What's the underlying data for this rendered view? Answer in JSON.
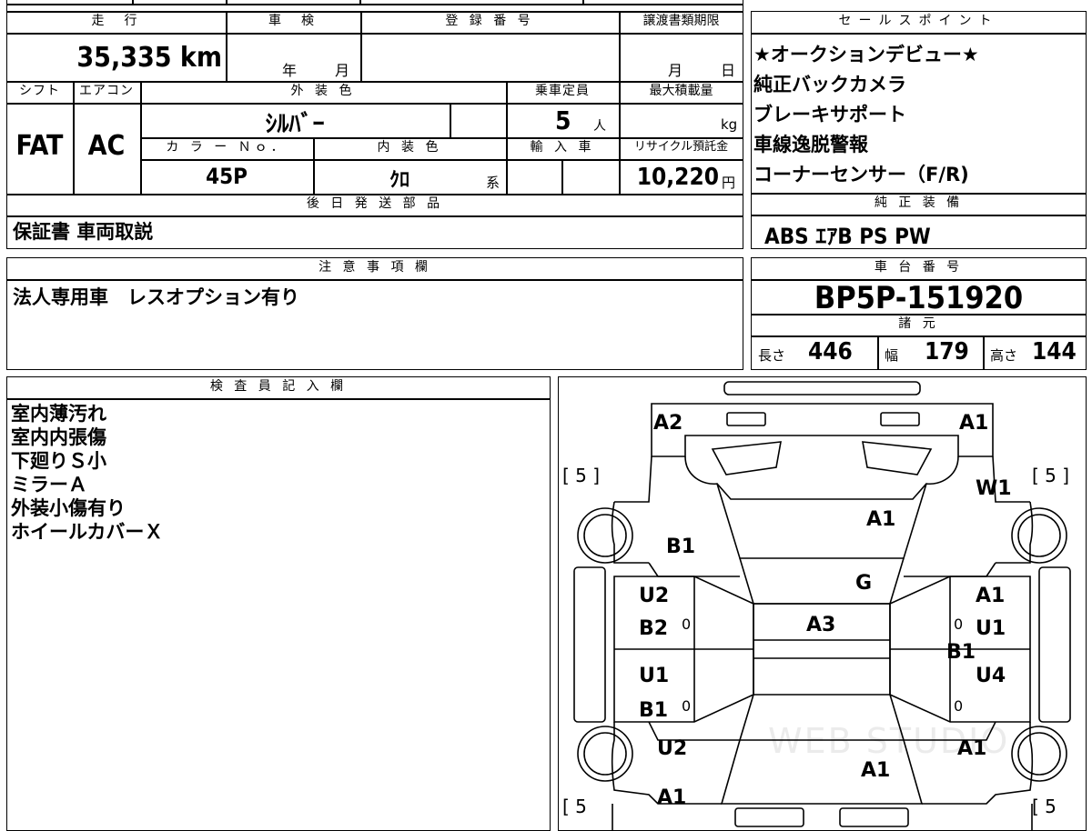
{
  "basic": {
    "mileage_hdr": "走　行",
    "mileage": "35,335 km",
    "shaken_hdr": "車　検",
    "shaken_year": "年",
    "shaken_month": "月",
    "reg_hdr": "登 録 番 号",
    "transfer_hdr": "譲渡書類期限",
    "transfer_month": "月",
    "transfer_day": "日",
    "shift_hdr": "シフト",
    "aircon_hdr": "エアコン",
    "color_hdr": "外 装 色",
    "capacity_hdr": "乗車定員",
    "maxload_hdr": "最大積載量",
    "shift": "FAT",
    "aircon": "AC",
    "color": "ｼﾙﾊﾞｰ",
    "capacity": "5",
    "capacity_unit": "人",
    "maxload_unit": "kg",
    "colorno_hdr": "カ ラ ー Ｎｏ．",
    "interior_hdr": "内 装 色",
    "import_hdr": "輸 入 車",
    "recycle_hdr": "リサイクル預託金",
    "colorno": "45P",
    "interior": "ｸﾛ",
    "interior_suffix": "系",
    "recycle": "10,220",
    "recycle_unit": "円"
  },
  "later": {
    "hdr": "後 日 発 送 部 品",
    "text": "保証書 車両取説"
  },
  "sales": {
    "hdr": "セールスポイント",
    "items": [
      "★オークションデビュー★",
      "純正バックカメラ",
      "ブレーキサポート",
      "車線逸脱警報",
      "コーナーセンサー（F/R)"
    ]
  },
  "equip": {
    "hdr": "純 正 装 備",
    "text": "ABS ｴｱB PS PW"
  },
  "caution": {
    "hdr": "注 意 事 項 欄",
    "text": "法人専用車　レスオプション有り"
  },
  "chassis": {
    "hdr": "車 台 番 号",
    "number": "BP5P-151920",
    "spec_hdr": "諸 元",
    "len_label": "長さ",
    "len": "446",
    "wid_label": "幅",
    "wid": "179",
    "hgt_label": "高さ",
    "hgt": "144"
  },
  "inspector": {
    "hdr": "検 査 員 記 入 欄",
    "lines": [
      "室内薄汚れ",
      "室内内張傷",
      "下廻りＳ小",
      "ミラーＡ",
      "外装小傷有り",
      "ホイールカバーＸ"
    ]
  },
  "diagram": {
    "tire_fl": "[ 5 ]",
    "tire_fr": "[ 5 ]",
    "tire_rl": "[ 5",
    "tire_rr": "[ 5",
    "labels": [
      "A2",
      "A1",
      "W1",
      "A1",
      "B1",
      "G",
      "U2",
      "A1",
      "B2",
      "0",
      "A3",
      "0",
      "U1",
      "B1",
      "U1",
      "U4",
      "B1",
      "0",
      "0",
      "U2",
      "A1",
      "A1",
      "A1"
    ],
    "watermark": "WEB STUDIO"
  }
}
